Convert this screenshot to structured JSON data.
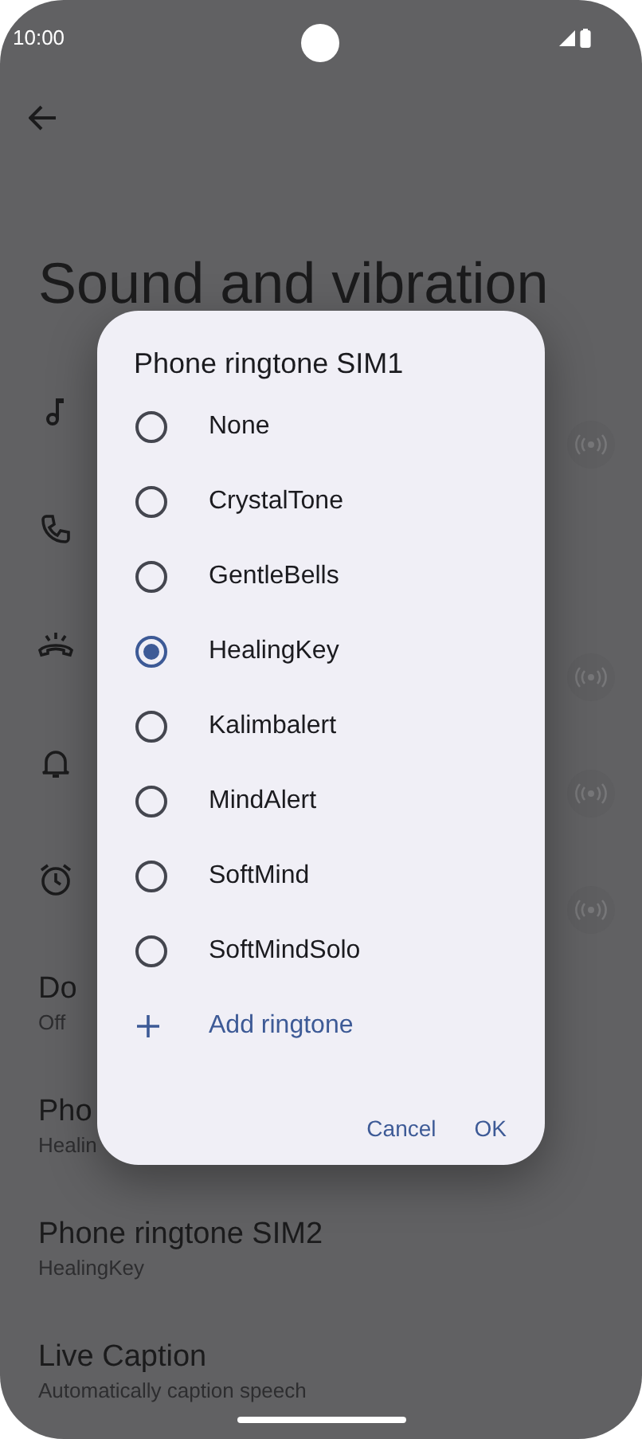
{
  "status_bar": {
    "time": "10:00"
  },
  "header": {
    "title": "Sound and vibration"
  },
  "settings": [
    {
      "title": "Do",
      "subtitle": "Off"
    },
    {
      "title": "Pho",
      "subtitle": "Healin"
    },
    {
      "title": "Phone ringtone SIM2",
      "subtitle": "HealingKey"
    },
    {
      "title": "Live Caption",
      "subtitle": "Automatically caption speech"
    }
  ],
  "dialog": {
    "title": "Phone ringtone SIM1",
    "options": [
      {
        "label": "None",
        "selected": false
      },
      {
        "label": "CrystalTone",
        "selected": false
      },
      {
        "label": "GentleBells",
        "selected": false
      },
      {
        "label": "HealingKey",
        "selected": true
      },
      {
        "label": "Kalimbalert",
        "selected": false
      },
      {
        "label": "MindAlert",
        "selected": false
      },
      {
        "label": "SoftMind",
        "selected": false
      },
      {
        "label": "SoftMindSolo",
        "selected": false
      }
    ],
    "add_label": "Add ringtone",
    "buttons": [
      "Cancel",
      "OK"
    ]
  }
}
